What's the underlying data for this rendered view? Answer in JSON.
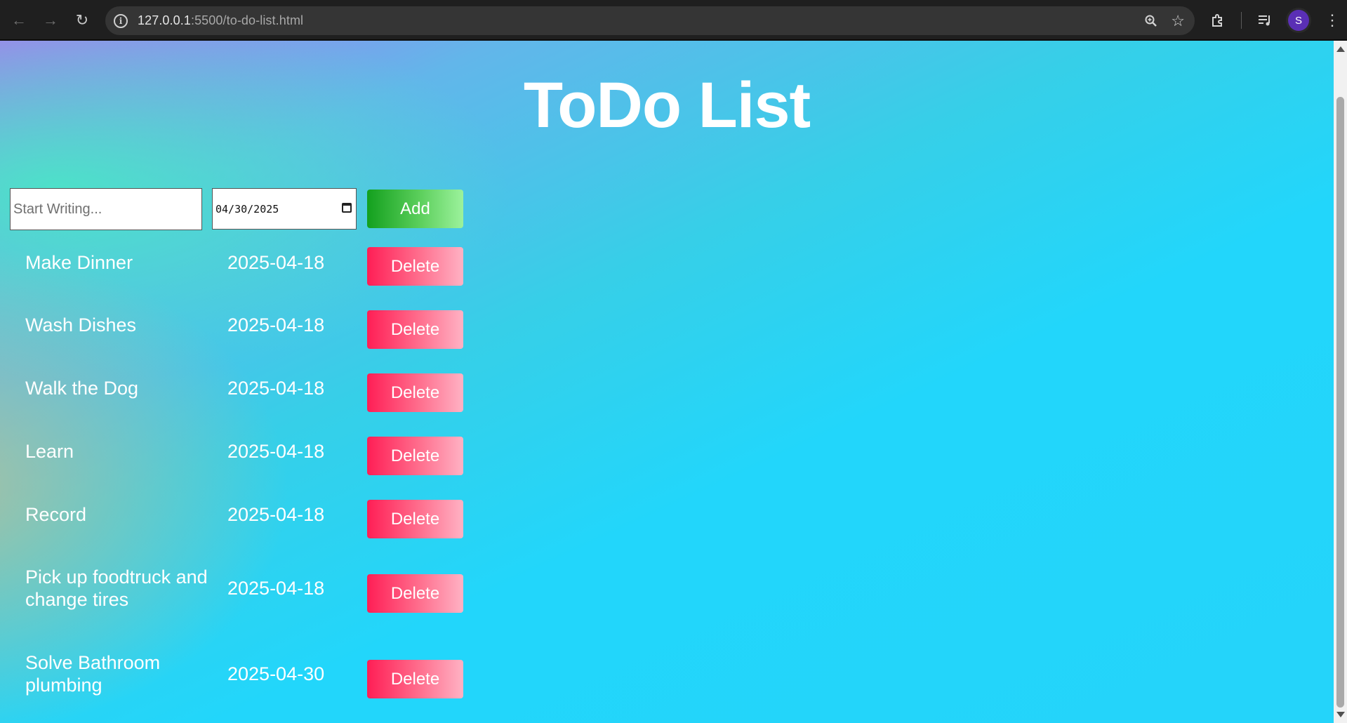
{
  "browser": {
    "url_host": "127.0.0.1",
    "url_rest": ":5500/to-do-list.html",
    "avatar_letter": "S",
    "icons": [
      "back-arrow-icon",
      "forward-arrow-icon",
      "reload-icon",
      "site-info-icon",
      "zoom-icon",
      "bookmark-star-icon",
      "extensions-icon",
      "media-controls-icon",
      "menu-kebab-icon"
    ]
  },
  "page": {
    "title": "ToDo List",
    "input_placeholder": "Start Writing...",
    "date_value": "04/30/2025",
    "add_label": "Add",
    "delete_label": "Delete",
    "colors": {
      "add_button": "#13a01e",
      "delete_button": "#ff1e55",
      "background_accent": "#22d6fb"
    }
  },
  "tasks": [
    {
      "name": "Make Dinner",
      "date": "2025-04-18"
    },
    {
      "name": "Wash Dishes",
      "date": "2025-04-18"
    },
    {
      "name": "Walk the Dog",
      "date": "2025-04-18"
    },
    {
      "name": "Learn",
      "date": "2025-04-18"
    },
    {
      "name": "Record",
      "date": "2025-04-18"
    },
    {
      "name": "Pick up foodtruck and change tires",
      "date": "2025-04-18"
    },
    {
      "name": "Solve Bathroom plumbing",
      "date": "2025-04-30"
    }
  ]
}
